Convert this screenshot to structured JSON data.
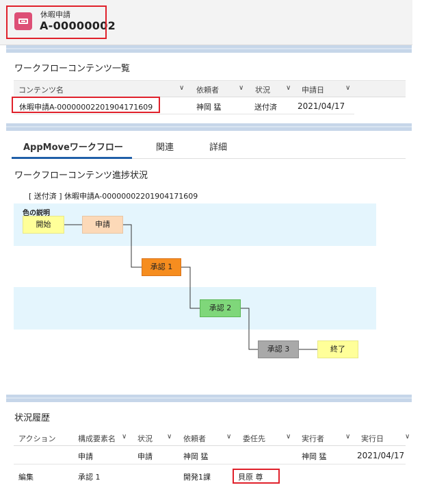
{
  "header": {
    "object_label": "休暇申請",
    "record_title": "A-00000002",
    "icon": "ticket-icon",
    "icon_color": "#dd4f76"
  },
  "workflow_contents": {
    "title": "ワークフローコンテンツ一覧",
    "columns": [
      "コンテンツ名",
      "依頼者",
      "状況",
      "申請日"
    ],
    "rows": [
      {
        "name": "休暇申請A-00000002201904171609",
        "requester": "神岡 猛",
        "status": "送付済",
        "date": "2021/04/17"
      }
    ]
  },
  "tabs": [
    {
      "label": "AppMoveワークフロー",
      "active": true
    },
    {
      "label": "関連",
      "active": false
    },
    {
      "label": "詳細",
      "active": false
    }
  ],
  "progress": {
    "title": "ワークフローコンテンツ進捗状況",
    "status_tag": "[ 送付済 ]",
    "content_link": "休暇申請A-00000002201904171609",
    "legend_label": "色の説明",
    "nodes": [
      {
        "label": "開始",
        "color": "#ffff99"
      },
      {
        "label": "申請",
        "color": "#fcd9b8"
      },
      {
        "label": "承認 1",
        "color": "#f68d1f"
      },
      {
        "label": "承認 2",
        "color": "#7fd77a"
      },
      {
        "label": "承認 3",
        "color": "#a9a9a9"
      },
      {
        "label": "終了",
        "color": "#ffff99"
      }
    ]
  },
  "history": {
    "title": "状況履歴",
    "columns": [
      "アクション",
      "構成要素名",
      "状況",
      "依頼者",
      "委任先",
      "実行者",
      "実行日"
    ],
    "rows": [
      {
        "action": "",
        "element": "申請",
        "status": "申請",
        "requester": "神岡 猛",
        "delegate": "",
        "executor": "神岡 猛",
        "date": "2021/04/17"
      },
      {
        "action": "編集",
        "element": "承認 1",
        "status": "",
        "requester": "開発1課",
        "delegate": "貝原 尊",
        "executor": "",
        "date": ""
      }
    ]
  },
  "accent_colors": {
    "highlight_red": "#e0202a",
    "link_blue": "#1f6fb6",
    "band_blue": "#c6d6e9"
  }
}
